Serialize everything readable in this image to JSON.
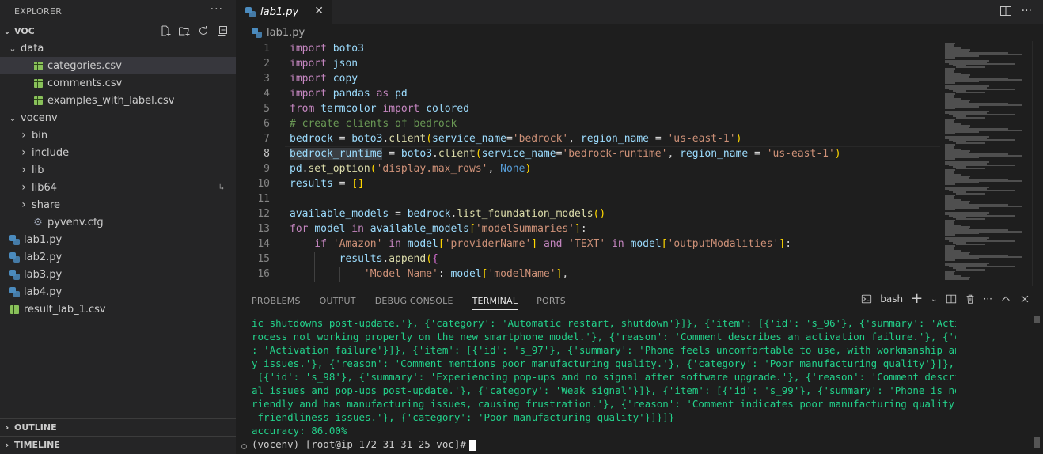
{
  "sidebar": {
    "title": "EXPLORER",
    "more": "···",
    "root": "VOC",
    "tree": [
      {
        "label": "data",
        "type": "folder",
        "expanded": true,
        "depth": 1
      },
      {
        "label": "categories.csv",
        "type": "csv",
        "depth": 2,
        "selected": true
      },
      {
        "label": "comments.csv",
        "type": "csv",
        "depth": 2
      },
      {
        "label": "examples_with_label.csv",
        "type": "csv",
        "depth": 2
      },
      {
        "label": "vocenv",
        "type": "folder",
        "expanded": true,
        "depth": 1
      },
      {
        "label": "bin",
        "type": "folder",
        "expanded": false,
        "depth": 2
      },
      {
        "label": "include",
        "type": "folder",
        "expanded": false,
        "depth": 2
      },
      {
        "label": "lib",
        "type": "folder",
        "expanded": false,
        "depth": 2
      },
      {
        "label": "lib64",
        "type": "folder",
        "expanded": false,
        "depth": 2,
        "symlink": true
      },
      {
        "label": "share",
        "type": "folder",
        "expanded": false,
        "depth": 2
      },
      {
        "label": "pyvenv.cfg",
        "type": "cfg",
        "depth": 2
      },
      {
        "label": "lab1.py",
        "type": "py",
        "depth": 1,
        "active": true
      },
      {
        "label": "lab2.py",
        "type": "py",
        "depth": 1
      },
      {
        "label": "lab3.py",
        "type": "py",
        "depth": 1
      },
      {
        "label": "lab4.py",
        "type": "py",
        "depth": 1
      },
      {
        "label": "result_lab_1.csv",
        "type": "csv",
        "depth": 1
      }
    ],
    "outline": "OUTLINE",
    "timeline": "TIMELINE"
  },
  "tab": {
    "label": "lab1.py",
    "close": "✕"
  },
  "breadcrumb": {
    "file": "lab1.py"
  },
  "editor": {
    "current_line": 8,
    "lines": [
      {
        "n": "1",
        "text": "import boto3"
      },
      {
        "n": "2",
        "text": "import json"
      },
      {
        "n": "3",
        "text": "import copy"
      },
      {
        "n": "4",
        "text": "import pandas as pd"
      },
      {
        "n": "5",
        "text": "from termcolor import colored"
      },
      {
        "n": "6",
        "text": "# create clients of bedrock"
      },
      {
        "n": "7",
        "text": "bedrock = boto3.client(service_name='bedrock', region_name = 'us-east-1')"
      },
      {
        "n": "8",
        "text": "bedrock_runtime = boto3.client(service_name='bedrock-runtime', region_name = 'us-east-1')"
      },
      {
        "n": "9",
        "text": "pd.set_option('display.max_rows', None)"
      },
      {
        "n": "10",
        "text": "results = []"
      },
      {
        "n": "11",
        "text": ""
      },
      {
        "n": "12",
        "text": "available_models = bedrock.list_foundation_models()"
      },
      {
        "n": "13",
        "text": "for model in available_models['modelSummaries']:"
      },
      {
        "n": "14",
        "text": "    if 'Amazon' in model['providerName'] and 'TEXT' in model['outputModalities']:"
      },
      {
        "n": "15",
        "text": "        results.append({"
      },
      {
        "n": "16",
        "text": "            'Model Name': model['modelName'],"
      }
    ]
  },
  "panel": {
    "tabs": [
      "PROBLEMS",
      "OUTPUT",
      "DEBUG CONSOLE",
      "TERMINAL",
      "PORTS"
    ],
    "active_tab": "TERMINAL",
    "shell": "bash",
    "terminal_lines": [
      "ic shutdowns post-update.'}, {'category': 'Automatic restart, shutdown'}]}, {'item': [{'id': 's_96'}, {'summary': 'Activation p",
      "rocess not working properly on the new smartphone model.'}, {'reason': 'Comment describes an activation failure.'}, {'category'",
      ": 'Activation failure'}]}, {'item': [{'id': 's_97'}, {'summary': 'Phone feels uncomfortable to use, with workmanship and qualit",
      "y issues.'}, {'reason': 'Comment mentions poor manufacturing quality.'}, {'category': 'Poor manufacturing quality'}]}, {'item':",
      " [{'id': 's_98'}, {'summary': 'Experiencing pop-ups and no signal after software upgrade.'}, {'reason': 'Comment describes sign",
      "al issues and pop-ups post-update.'}, {'category': 'Weak signal'}]}, {'item': [{'id': 's_99'}, {'summary': 'Phone is not user-f",
      "riendly and has manufacturing issues, causing frustration.'}, {'reason': 'Comment indicates poor manufacturing quality and user",
      "-friendliness issues.'}, {'category': 'Poor manufacturing quality'}]}]}",
      "accuracy: 86.00%"
    ],
    "prompt": "(vocenv) [root@ip-172-31-31-25 voc]#"
  },
  "colors": {
    "terminal_text": "#23d18b",
    "accent": "#007acc"
  }
}
